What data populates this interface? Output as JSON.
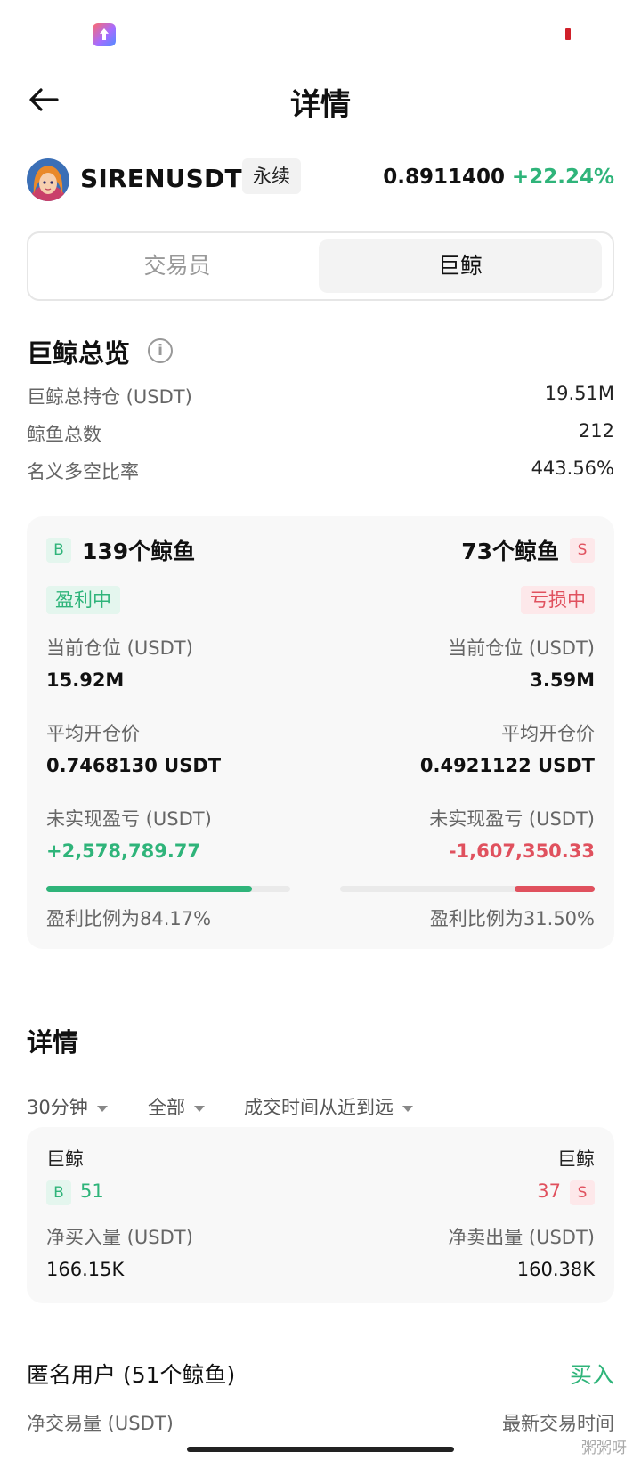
{
  "nav": {
    "title": "详情"
  },
  "ticker": {
    "symbol": "SIRENUSDT",
    "tag": "永续",
    "price": "0.8911400",
    "change": "+22.24%"
  },
  "tabs": {
    "left": "交易员",
    "right": "巨鲸"
  },
  "overview": {
    "title": "巨鲸总览",
    "info_glyph": "i",
    "stats": [
      {
        "label": "巨鲸总持仓 (USDT)",
        "value": "19.51M"
      },
      {
        "label": "鲸鱼总数",
        "value": "212"
      },
      {
        "label": "名义多空比率",
        "value": "443.56%"
      }
    ]
  },
  "whale_card": {
    "long": {
      "badge": "B",
      "count": "139个鲸鱼",
      "status": "盈利中",
      "position_label": "当前仓位 (USDT)",
      "position": "15.92M",
      "avg_label": "平均开仓价",
      "avg": "0.7468130 USDT",
      "pnl_label": "未实现盈亏 (USDT)",
      "pnl": "+2,578,789.77",
      "ratio_text": "盈利比例为84.17%",
      "ratio": 0.8417
    },
    "short": {
      "badge": "S",
      "count": "73个鲸鱼",
      "status": "亏损中",
      "position_label": "当前仓位 (USDT)",
      "position": "3.59M",
      "avg_label": "平均开仓价",
      "avg": "0.4921122 USDT",
      "pnl_label": "未实现盈亏 (USDT)",
      "pnl": "-1,607,350.33",
      "ratio_text": "盈利比例为31.50%",
      "ratio": 0.315
    }
  },
  "details": {
    "title": "详情",
    "filters": [
      "30分钟",
      "全部",
      "成交时间从近到远"
    ],
    "card": {
      "left_title": "巨鲸",
      "left_badge": "B",
      "left_count": "51",
      "right_title": "巨鲸",
      "right_badge": "S",
      "right_count": "37",
      "buy_label": "净买入量 (USDT)",
      "buy_value": "166.15K",
      "sell_label": "净卖出量 (USDT)",
      "sell_value": "160.38K"
    }
  },
  "anon": {
    "title": "匿名用户 (51个鲸鱼)",
    "action": "买入",
    "col_left": "净交易量 (USDT)",
    "col_right": "最新交易时间"
  },
  "watermark": "粥粥呀",
  "colors": {
    "green": "#2fb47a",
    "red": "#e0515e"
  }
}
